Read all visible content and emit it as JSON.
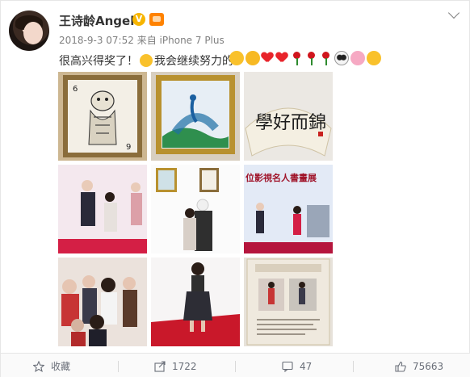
{
  "post": {
    "username": "王诗龄Angela",
    "verified_badge": "V",
    "date": "2018-9-3 07:52",
    "source_prefix": "来自",
    "source": "iPhone 7 Plus",
    "text_part1": "很高兴得奖了！",
    "text_part2": "我会继续努力的！",
    "emojis": [
      "smile-emoji",
      "laugh-emoji",
      "red-heart",
      "red-heart",
      "rose",
      "rose",
      "rose",
      "panda-emoji",
      "pink-pig-emoji",
      "yellow-grin-emoji"
    ]
  },
  "photos": [
    {
      "name": "playing-card-painting",
      "kind": "artwork"
    },
    {
      "name": "peacock-painting",
      "kind": "artwork"
    },
    {
      "name": "calligraphy-fan",
      "kind": "artwork",
      "text": "學好而錦"
    },
    {
      "name": "award-stage-photo",
      "kind": "event"
    },
    {
      "name": "exhibition-photo",
      "kind": "event"
    },
    {
      "name": "stage-banner-photo",
      "kind": "event",
      "text": "位影視名人書畫展"
    },
    {
      "name": "crowd-photo",
      "kind": "event"
    },
    {
      "name": "red-carpet-photo",
      "kind": "event"
    },
    {
      "name": "exhibition-board-photo",
      "kind": "event"
    }
  ],
  "actions": {
    "favorite": "收藏",
    "repost_count": "1722",
    "comment_count": "47",
    "like_count": "75663"
  },
  "colors": {
    "text": "#333333",
    "meta": "#808080",
    "action_text": "#696e78",
    "verified": "#f7b500",
    "member": "#ff8200"
  }
}
